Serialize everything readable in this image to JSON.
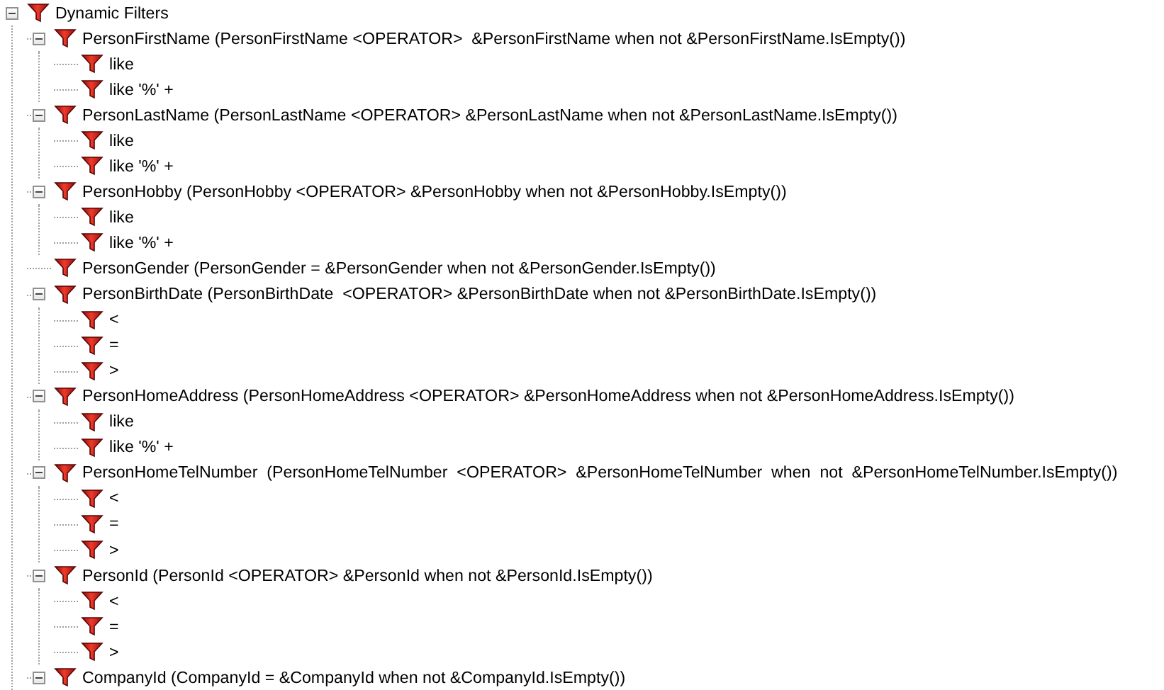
{
  "tree": {
    "label": "Dynamic Filters",
    "expanded": true,
    "children": [
      {
        "label": "PersonFirstName (PersonFirstName <OPERATOR>  &PersonFirstName when not &PersonFirstName.IsEmpty())",
        "expanded": true,
        "children": [
          {
            "label": "like"
          },
          {
            "label": "like '%' +"
          }
        ]
      },
      {
        "label": "PersonLastName (PersonLastName <OPERATOR> &PersonLastName when not &PersonLastName.IsEmpty())",
        "expanded": true,
        "children": [
          {
            "label": "like"
          },
          {
            "label": "like '%' +"
          }
        ]
      },
      {
        "label": "PersonHobby (PersonHobby <OPERATOR> &PersonHobby when not &PersonHobby.IsEmpty())",
        "expanded": true,
        "children": [
          {
            "label": "like"
          },
          {
            "label": "like '%' +"
          }
        ]
      },
      {
        "label": "PersonGender (PersonGender = &PersonGender when not &PersonGender.IsEmpty())"
      },
      {
        "label": "PersonBirthDate (PersonBirthDate  <OPERATOR> &PersonBirthDate when not &PersonBirthDate.IsEmpty())",
        "expanded": true,
        "children": [
          {
            "label": "<"
          },
          {
            "label": "="
          },
          {
            "label": ">"
          }
        ]
      },
      {
        "label": "PersonHomeAddress (PersonHomeAddress <OPERATOR> &PersonHomeAddress when not &PersonHomeAddress.IsEmpty())",
        "expanded": true,
        "children": [
          {
            "label": "like"
          },
          {
            "label": "like '%' +"
          }
        ]
      },
      {
        "label": "PersonHomeTelNumber  (PersonHomeTelNumber  <OPERATOR>  &PersonHomeTelNumber  when  not  &PersonHomeTelNumber.IsEmpty())",
        "expanded": true,
        "children": [
          {
            "label": "<"
          },
          {
            "label": "="
          },
          {
            "label": ">"
          }
        ]
      },
      {
        "label": "PersonId (PersonId <OPERATOR> &PersonId when not &PersonId.IsEmpty())",
        "expanded": true,
        "children": [
          {
            "label": "<"
          },
          {
            "label": "="
          },
          {
            "label": ">"
          }
        ]
      },
      {
        "label": "CompanyId (CompanyId = &CompanyId when not &CompanyId.IsEmpty())",
        "expanded": true
      }
    ]
  }
}
